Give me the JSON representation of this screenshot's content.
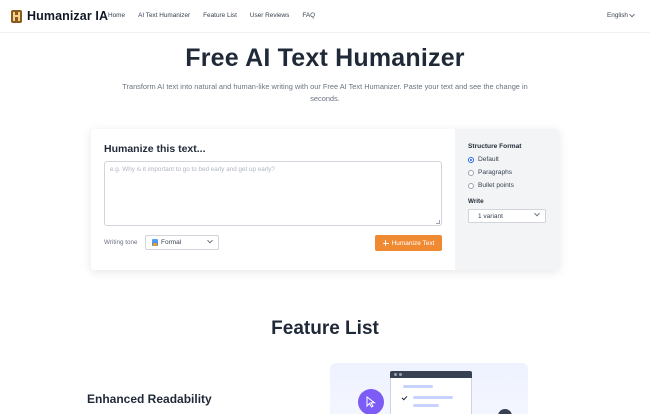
{
  "header": {
    "logo_text": "Humanizar IA",
    "nav_links": [
      "Home",
      "AI Text Humanizer",
      "Feature List",
      "User Reviews",
      "FAQ"
    ],
    "language": "English"
  },
  "hero": {
    "title": "Free AI Text Humanizer",
    "subtitle": "Transform AI text into natural and human-like writing with our Free AI Text Humanizer. Paste your text and see the change in seconds."
  },
  "humanizer": {
    "title": "Humanize this text...",
    "input_value": "",
    "input_placeholder": "e.g. Why is it important to go to bed early and get up early?",
    "tone_label": "Writing tone",
    "tone_selected": "Formal",
    "submit_label": "Humanize Text"
  },
  "options": {
    "structure_title": "Structure Format",
    "structure_options": [
      "Default",
      "Paragraphs",
      "Bullet points"
    ],
    "structure_selected": "Default",
    "write_label": "Write",
    "variant_selected": "1 variant"
  },
  "features": {
    "title": "Feature List",
    "first_heading": "Enhanced Readability"
  },
  "colors": {
    "accent": "#f08a32",
    "radio_selected": "#2563eb",
    "panel_bg": "#f3f4f6",
    "illustration_accent": "#7c5cf4"
  },
  "icons": [
    "logo-icon",
    "chevron-down-icon",
    "tone-icon",
    "sparkle-icon",
    "cursor-icon",
    "check-icon"
  ]
}
